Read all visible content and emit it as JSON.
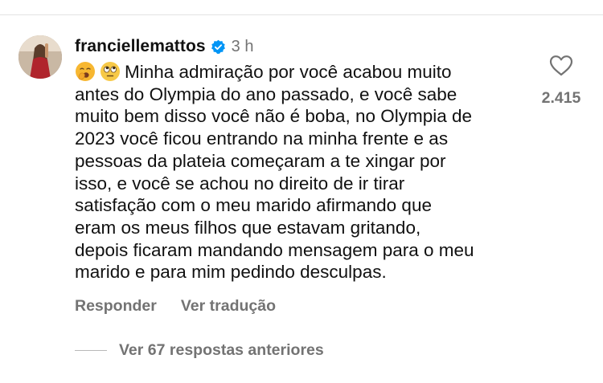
{
  "comment": {
    "username": "franciellemattos",
    "time": "3 h",
    "emojis": [
      "yawning-face",
      "face-with-rolling-eyes"
    ],
    "lines": [
      "Minha admiração por você acabou muito",
      "antes do Olympia do ano passado, e você sabe",
      "muito bem disso você não é boba, no Olympia de",
      "2023 você ficou entrando na minha frente e as",
      "pessoas da plateia começaram a te xingar por",
      "isso, e você se achou no direito de ir tirar",
      "satisfação com o meu marido afirmando que",
      "eram os meus filhos que estavam gritando,",
      "depois ficaram mandando mensagem para o meu",
      "marido e para mim pedindo desculpas."
    ],
    "like_count": "2.415",
    "reply_label": "Responder",
    "translate_label": "Ver tradução",
    "view_replies_label": "Ver 67 respostas anteriores"
  },
  "colors": {
    "text": "#111111",
    "muted": "#737373",
    "verified_badge": "#0095f6"
  },
  "icons": {
    "verified": "verified-badge-icon",
    "like": "heart-icon"
  }
}
